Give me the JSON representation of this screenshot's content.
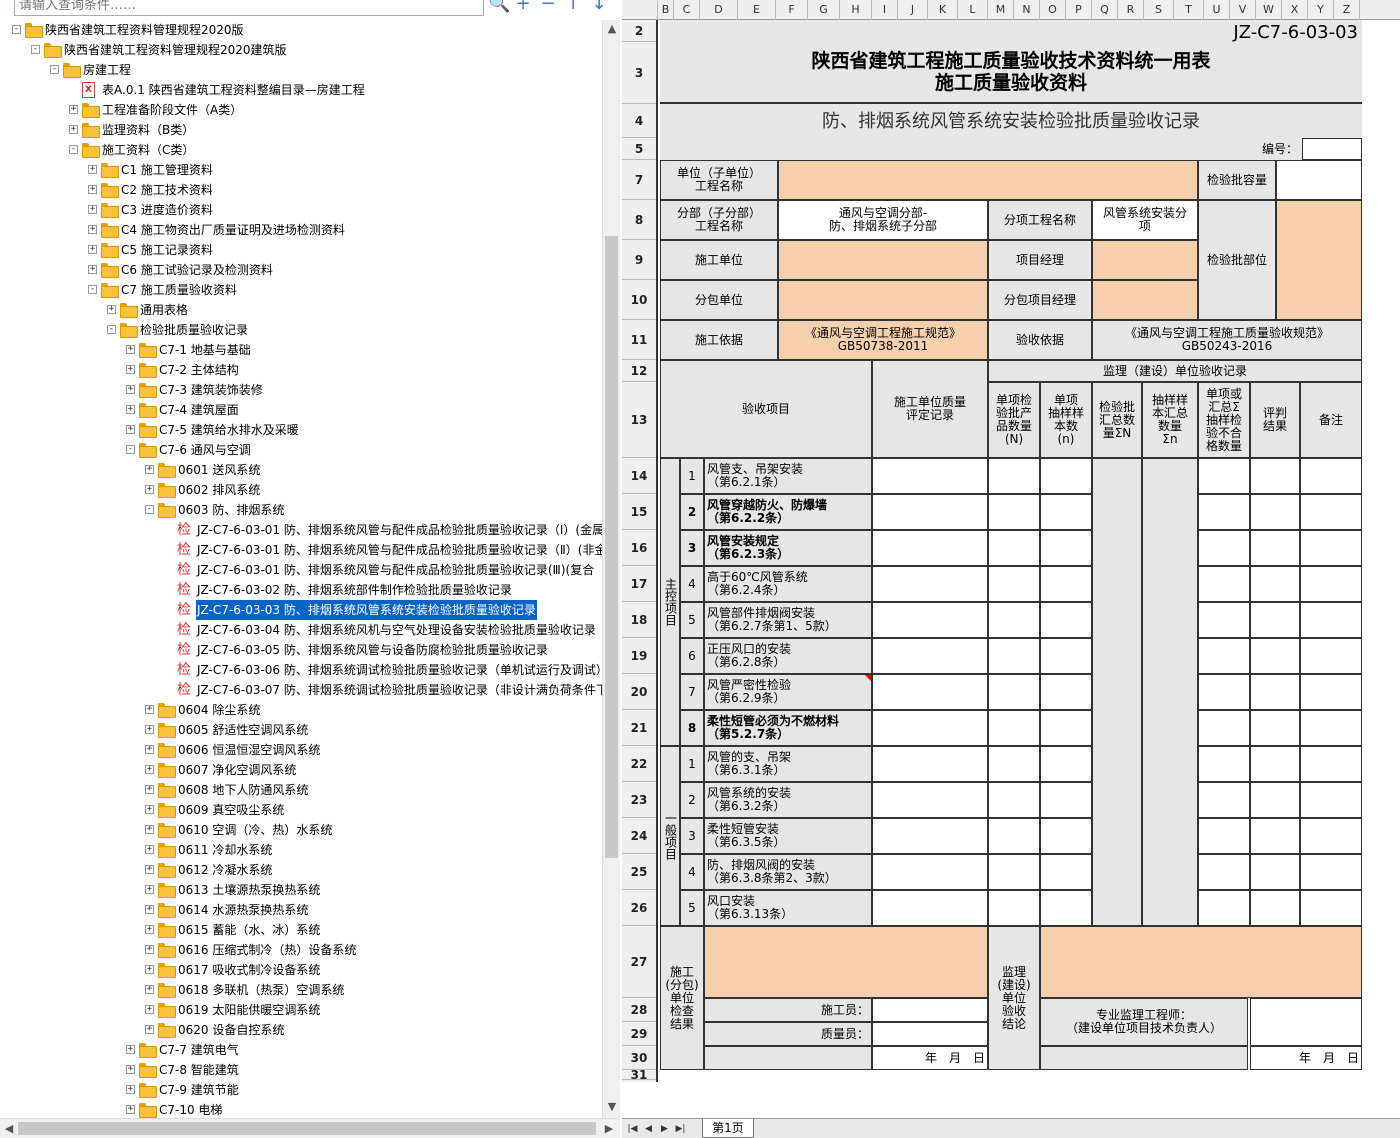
{
  "search": {
    "placeholder": "请输入查询条件……"
  },
  "toolbar": {
    "search_icon": "🔍",
    "add_icon": "+",
    "remove_icon": "−",
    "up_icon": "↑",
    "down_icon": "↓"
  },
  "tree": [
    {
      "level": 0,
      "type": "folder",
      "exp": "-",
      "label": "陕西省建筑工程资料管理规程2020版"
    },
    {
      "level": 1,
      "type": "folder",
      "exp": "-",
      "label": "陕西省建筑工程资料管理规程2020建筑版"
    },
    {
      "level": 2,
      "type": "folder",
      "exp": "-",
      "label": "房建工程"
    },
    {
      "level": 3,
      "type": "doc",
      "exp": "",
      "label": "表A.0.1 陕西省建筑工程资料整编目录—房建工程"
    },
    {
      "level": 3,
      "type": "folder",
      "exp": "+",
      "label": "工程准备阶段文件（A类）"
    },
    {
      "level": 3,
      "type": "folder",
      "exp": "+",
      "label": "监理资料（B类）"
    },
    {
      "level": 3,
      "type": "folder",
      "exp": "-",
      "label": "施工资料（C类）"
    },
    {
      "level": 4,
      "type": "folder",
      "exp": "+",
      "label": "C1 施工管理资料"
    },
    {
      "level": 4,
      "type": "folder",
      "exp": "+",
      "label": "C2 施工技术资料"
    },
    {
      "level": 4,
      "type": "folder",
      "exp": "+",
      "label": "C3 进度造价资料"
    },
    {
      "level": 4,
      "type": "folder",
      "exp": "+",
      "label": "C4 施工物资出厂质量证明及进场检测资料"
    },
    {
      "level": 4,
      "type": "folder",
      "exp": "+",
      "label": "C5 施工记录资料"
    },
    {
      "level": 4,
      "type": "folder",
      "exp": "+",
      "label": "C6 施工试验记录及检测资料"
    },
    {
      "level": 4,
      "type": "folder",
      "exp": "-",
      "label": "C7 施工质量验收资料"
    },
    {
      "level": 5,
      "type": "folder",
      "exp": "+",
      "label": "通用表格"
    },
    {
      "level": 5,
      "type": "folder",
      "exp": "-",
      "label": "检验批质量验收记录"
    },
    {
      "level": 6,
      "type": "folder",
      "exp": "+",
      "label": "C7-1 地基与基础"
    },
    {
      "level": 6,
      "type": "folder",
      "exp": "+",
      "label": "C7-2 主体结构"
    },
    {
      "level": 6,
      "type": "folder",
      "exp": "+",
      "label": "C7-3 建筑装饰装修"
    },
    {
      "level": 6,
      "type": "folder",
      "exp": "+",
      "label": "C7-4 建筑屋面"
    },
    {
      "level": 6,
      "type": "folder",
      "exp": "+",
      "label": "C7-5 建筑给水排水及采暖"
    },
    {
      "level": 6,
      "type": "folder",
      "exp": "-",
      "label": "C7-6 通风与空调"
    },
    {
      "level": 7,
      "type": "folder",
      "exp": "+",
      "label": "0601 送风系统"
    },
    {
      "level": 7,
      "type": "folder",
      "exp": "+",
      "label": "0602 排风系统"
    },
    {
      "level": 7,
      "type": "folder",
      "exp": "-",
      "label": "0603 防、排烟系统"
    },
    {
      "level": 8,
      "type": "jian",
      "exp": "",
      "label": "JZ-C7-6-03-01 防、排烟系统风管与配件成品检验批质量验收记录（Ⅰ）(金属"
    },
    {
      "level": 8,
      "type": "jian",
      "exp": "",
      "label": "JZ-C7-6-03-01 防、排烟系统风管与配件成品检验批质量验收记录（Ⅱ）(非金"
    },
    {
      "level": 8,
      "type": "jian",
      "exp": "",
      "label": "JZ-C7-6-03-01 防、排烟系统风管与配件成品检验批质量验收记录(Ⅲ)(复合"
    },
    {
      "level": 8,
      "type": "jian",
      "exp": "",
      "label": "JZ-C7-6-03-02 防、排烟系统部件制作检验批质量验收记录"
    },
    {
      "level": 8,
      "type": "jian",
      "exp": "",
      "label": "JZ-C7-6-03-03 防、排烟系统风管系统安装检验批质量验收记录",
      "selected": true
    },
    {
      "level": 8,
      "type": "jian",
      "exp": "",
      "label": "JZ-C7-6-03-04 防、排烟系统风机与空气处理设备安装检验批质量验收记录"
    },
    {
      "level": 8,
      "type": "jian",
      "exp": "",
      "label": "JZ-C7-6-03-05 防、排烟系统风管与设备防腐检验批质量验收记录"
    },
    {
      "level": 8,
      "type": "jian",
      "exp": "",
      "label": "JZ-C7-6-03-06 防、排烟系统调试检验批质量验收记录（单机试运行及调试）"
    },
    {
      "level": 8,
      "type": "jian",
      "exp": "",
      "label": "JZ-C7-6-03-07 防、排烟系统调试检验批质量验收记录（非设计满负荷条件下"
    },
    {
      "level": 7,
      "type": "folder",
      "exp": "+",
      "label": "0604 除尘系统"
    },
    {
      "level": 7,
      "type": "folder",
      "exp": "+",
      "label": "0605 舒适性空调风系统"
    },
    {
      "level": 7,
      "type": "folder",
      "exp": "+",
      "label": "0606 恒温恒湿空调风系统"
    },
    {
      "level": 7,
      "type": "folder",
      "exp": "+",
      "label": "0607 净化空调风系统"
    },
    {
      "level": 7,
      "type": "folder",
      "exp": "+",
      "label": "0608 地下人防通风系统"
    },
    {
      "level": 7,
      "type": "folder",
      "exp": "+",
      "label": "0609 真空吸尘系统"
    },
    {
      "level": 7,
      "type": "folder",
      "exp": "+",
      "label": "0610 空调（冷、热）水系统"
    },
    {
      "level": 7,
      "type": "folder",
      "exp": "+",
      "label": "0611 冷却水系统"
    },
    {
      "level": 7,
      "type": "folder",
      "exp": "+",
      "label": "0612 冷凝水系统"
    },
    {
      "level": 7,
      "type": "folder",
      "exp": "+",
      "label": "0613 土壤源热泵换热系统"
    },
    {
      "level": 7,
      "type": "folder",
      "exp": "+",
      "label": "0614 水源热泵换热系统"
    },
    {
      "level": 7,
      "type": "folder",
      "exp": "+",
      "label": "0615 蓄能（水、冰）系统"
    },
    {
      "level": 7,
      "type": "folder",
      "exp": "+",
      "label": "0616 压缩式制冷（热）设备系统"
    },
    {
      "level": 7,
      "type": "folder",
      "exp": "+",
      "label": "0617 吸收式制冷设备系统"
    },
    {
      "level": 7,
      "type": "folder",
      "exp": "+",
      "label": "0618 多联机（热泵）空调系统"
    },
    {
      "level": 7,
      "type": "folder",
      "exp": "+",
      "label": "0619 太阳能供暖空调系统"
    },
    {
      "level": 7,
      "type": "folder",
      "exp": "+",
      "label": "0620 设备自控系统"
    },
    {
      "level": 6,
      "type": "folder",
      "exp": "+",
      "label": "C7-7 建筑电气"
    },
    {
      "level": 6,
      "type": "folder",
      "exp": "+",
      "label": "C7-8 智能建筑"
    },
    {
      "level": 6,
      "type": "folder",
      "exp": "+",
      "label": "C7-9 建筑节能"
    },
    {
      "level": 6,
      "type": "folder",
      "exp": "+",
      "label": "C7-10 电梯"
    }
  ],
  "jian_char": "检",
  "doc_char": "X",
  "columns": [
    "B",
    "C",
    "D",
    "E",
    "F",
    "G",
    "H",
    "I",
    "J",
    "K",
    "L",
    "M",
    "N",
    "O",
    "P",
    "Q",
    "R",
    "S",
    "T",
    "U",
    "V",
    "W",
    "X",
    "Y",
    "Z"
  ],
  "rows": [
    "2",
    "3",
    "4",
    "5",
    "7",
    "8",
    "9",
    "10",
    "11",
    "12",
    "13",
    "14",
    "15",
    "16",
    "17",
    "18",
    "19",
    "20",
    "21",
    "22",
    "23",
    "24",
    "25",
    "26",
    "27",
    "28",
    "29",
    "30",
    "31"
  ],
  "form": {
    "code": "JZ-C7-6-03-03",
    "title1": "陕西省建筑工程施工质量验收技术资料统一用表",
    "title2": "施工质量验收资料",
    "subtitle": "防、排烟系统风管系统安装检验批质量验收记录",
    "number_label": "编号：",
    "unit_project": "单位（子单位）\n工程名称",
    "batch_capacity": "检验批容量",
    "division": "分部（子分部）\n工程名称",
    "division_value": "通风与空调分部-\n防、排烟系统子分部",
    "sub_item": "分项工程名称",
    "sub_item_value": "风管系统安装分\n项",
    "batch_location": "检验批部位",
    "construction_unit": "施工单位",
    "project_manager": "项目经理",
    "subcontractor": "分包单位",
    "sub_manager": "分包项目经理",
    "basis": "施工依据",
    "basis_value": "《通风与空调工程施工规范》\nGB50738-2011",
    "acceptance_basis": "验收依据",
    "acceptance_value": "《通风与空调工程施工质量验收规范》\nGB50243-2016",
    "supervision_record": "监理（建设）单位验收记录",
    "item_header": "验收项目",
    "eval_record": "施工单位质量\n评定记录",
    "h_min": "单项检\n验批产\n品数量\n(N)",
    "h_sample": "单项\n抽样样\n本数\n(n)",
    "h_total": "检验批\n汇总数\n量ΣN",
    "h_sample_total": "抽样样\n本汇总\n数量\nΣn",
    "h_fail": "单项或\n汇总Σ\n抽样检\n验不合\n格数量",
    "h_result": "评判\n结果",
    "h_remark": "备注",
    "main_group": "主控项目",
    "general_group": "一般项目",
    "main_items": [
      {
        "n": "1",
        "text": "风管支、吊架安装\n（第6.2.1条）",
        "bold": false
      },
      {
        "n": "2",
        "text": "风管穿越防火、防爆墙\n（第6.2.2条）",
        "bold": true
      },
      {
        "n": "3",
        "text": "风管安装规定\n（第6.2.3条）",
        "bold": true
      },
      {
        "n": "4",
        "text": "高于60℃风管系统\n（第6.2.4条）",
        "bold": false
      },
      {
        "n": "5",
        "text": "风管部件排烟阀安装\n（第6.2.7条第1、5款）",
        "bold": false
      },
      {
        "n": "6",
        "text": "正压风口的安装\n（第6.2.8条）",
        "bold": false
      },
      {
        "n": "7",
        "text": "风管严密性检验\n（第6.2.9条）",
        "bold": false
      },
      {
        "n": "8",
        "text": "柔性短管必须为不燃材料\n（第5.2.7条）",
        "bold": true
      }
    ],
    "general_items": [
      {
        "n": "1",
        "text": "风管的支、吊架\n（第6.3.1条）"
      },
      {
        "n": "2",
        "text": "风管系统的安装\n（第6.3.2条）"
      },
      {
        "n": "3",
        "text": "柔性短管安装\n（第6.3.5条）"
      },
      {
        "n": "4",
        "text": "防、排烟风阀的安装\n（第6.3.8条第2、3款）"
      },
      {
        "n": "5",
        "text": "风口安装\n（第6.3.13条）"
      }
    ],
    "check_result": "施工\n(分包)\n单位\n检查\n结果",
    "builder": "施工员：",
    "quality": "质量员：",
    "date": "年　月　日",
    "supervision_conclusion": "监理\n(建设)\n单位\n验收\n结论",
    "supervisor": "专业监理工程师：\n（建设单位项目技术负责人）",
    "date2": "年　月　日"
  },
  "sheet_tab": "第1页",
  "nav": [
    "|◀",
    "◀",
    "▶",
    "▶|"
  ]
}
